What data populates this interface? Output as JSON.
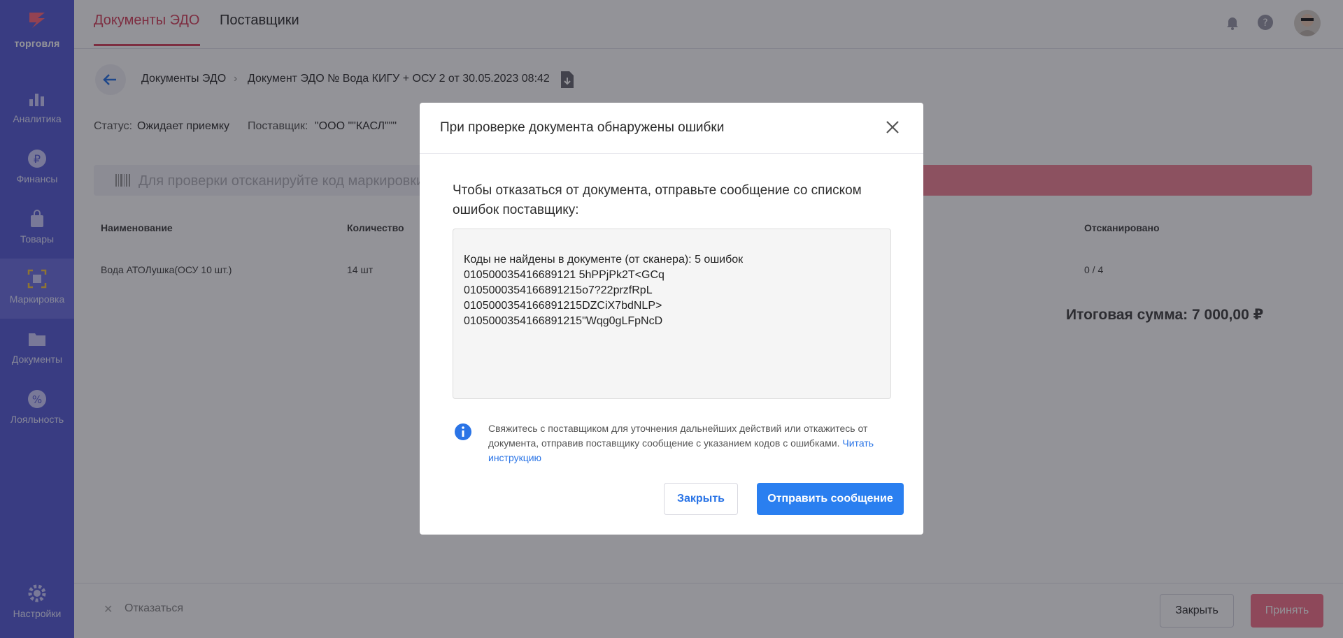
{
  "brand": {
    "name": "торговля",
    "accent": "#d6455e",
    "sidebar_color": "#5a5ed6"
  },
  "sidebar": {
    "items": [
      {
        "label": "Аналитика",
        "icon": "bar-chart-icon"
      },
      {
        "label": "Финансы",
        "icon": "ruble-icon"
      },
      {
        "label": "Товары",
        "icon": "bag-icon"
      },
      {
        "label": "Маркировка",
        "icon": "barcode-scan-icon",
        "active": true
      },
      {
        "label": "Документы",
        "icon": "folder-icon"
      },
      {
        "label": "Лояльность",
        "icon": "percent-badge-icon"
      }
    ],
    "settings_label": "Настройки"
  },
  "topbar": {
    "tabs": [
      {
        "label": "Документы ЭДО",
        "active": true
      },
      {
        "label": "Поставщики"
      }
    ]
  },
  "breadcrumb": {
    "root": "Документы ЭДО",
    "current": "Документ ЭДО № Вода КИГУ + ОСУ 2 от 30.05.2023 08:42"
  },
  "status": {
    "label": "Статус:",
    "value": "Ожидает приемку",
    "supplier_label": "Поставщик:",
    "supplier_value": "\"ООО \"\"КАСЛ\"\"\""
  },
  "scan": {
    "placeholder": "Для проверки отсканируйте код маркировки"
  },
  "table": {
    "headers": {
      "name": "Наименование",
      "qty": "Количество",
      "scanned": "Отсканировано"
    },
    "rows": [
      {
        "name": "Вода АТОЛушка(ОСУ 10 шт.)",
        "qty": "14 шт",
        "scanned": "0 / 4"
      }
    ]
  },
  "total": "Итоговая сумма: 7 000,00 ₽",
  "footer": {
    "refuse": "Отказаться",
    "close": "Закрыть",
    "accept": "Принять"
  },
  "modal": {
    "title": "При проверке документа обнаружены ошибки",
    "description": "Чтобы отказаться от документа, отправьте сообщение со списком ошибок поставщику:",
    "codes_header": "Коды не найдены в документе (от сканера): 5 ошибок",
    "codes": [
      "010500035416689121 5hPPjPk2T<GCq",
      "0105000354166891215o7?22przfRpL",
      "0105000354166891215DZCiX7bdNLP>",
      "0105000354166891215\"Wqg0gLFpNcD"
    ],
    "info_text": "Свяжитесь с поставщиком для уточнения дальнейших действий или откажитесь от документа, отправив поставщику сообщение с указанием кодов с ошибками.",
    "info_link": "Читать инструкцию",
    "close_button": "Закрыть",
    "send_button": "Отправить сообщение"
  }
}
